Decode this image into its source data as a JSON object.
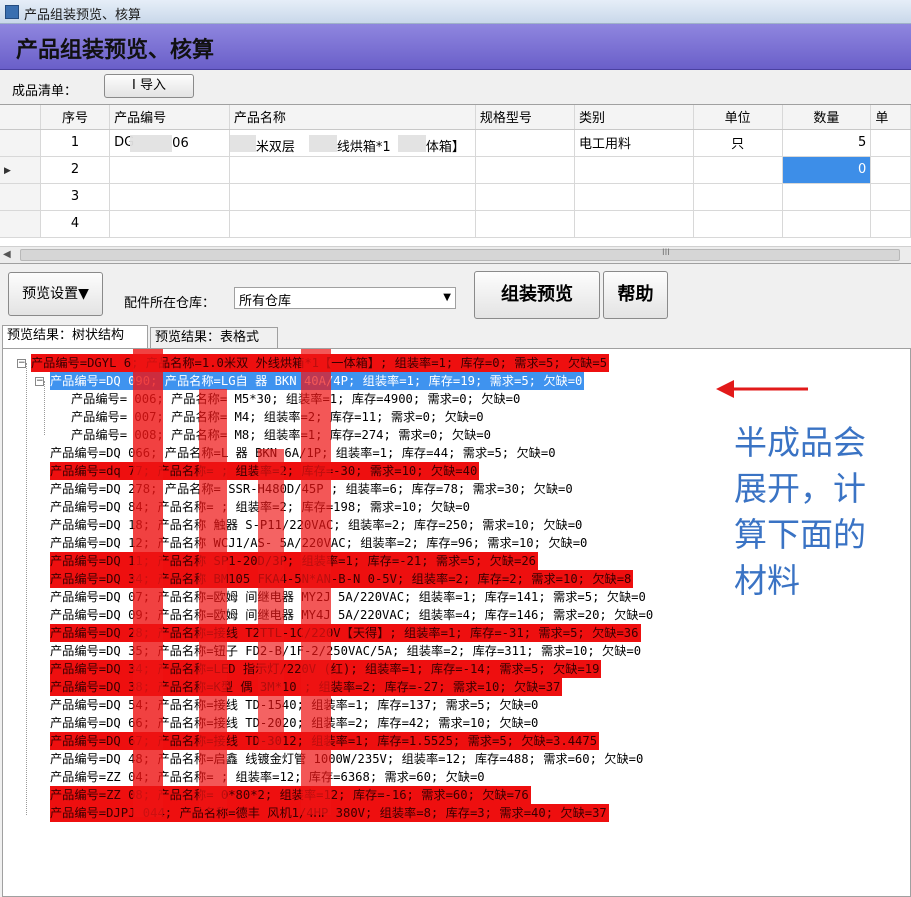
{
  "window": {
    "title": "产品组装预览、核算"
  },
  "banner": {
    "heading": "产品组装预览、核算"
  },
  "toolbar": {
    "list_label": "成品清单：",
    "import_label": "I 导入"
  },
  "grid": {
    "columns": [
      "",
      "序号",
      "产品编号",
      "产品名称",
      "规格型号",
      "类别",
      "单位",
      "数量",
      "单"
    ],
    "rows": [
      {
        "marker": "",
        "no": "1",
        "code": "DG",
        "code_tail": "06",
        "name_a": "米双层",
        "name_b": "线烘箱*1",
        "name_c": "体箱】",
        "spec": "",
        "category": "电工用料",
        "unit": "只",
        "qty": "5"
      },
      {
        "marker": "▶",
        "no": "2",
        "code": "",
        "code_tail": "",
        "name_a": "",
        "name_b": "",
        "name_c": "",
        "spec": "",
        "category": "",
        "unit": "",
        "qty": "0"
      },
      {
        "marker": "",
        "no": "3",
        "code": "",
        "code_tail": "",
        "name_a": "",
        "name_b": "",
        "name_c": "",
        "spec": "",
        "category": "",
        "unit": "",
        "qty": ""
      },
      {
        "marker": "",
        "no": "4",
        "code": "",
        "code_tail": "",
        "name_a": "",
        "name_b": "",
        "name_c": "",
        "spec": "",
        "category": "",
        "unit": "",
        "qty": ""
      }
    ],
    "scroll_grip": "III"
  },
  "controls": {
    "preview_settings_label": "预览设置▼",
    "warehouse_label": "配件所在仓库：",
    "warehouse_value": "所有仓库",
    "assemble_preview_label": "组装预览",
    "help_label": "帮助"
  },
  "tabs": [
    {
      "label": "预览结果：树状结构"
    },
    {
      "label": "预览结果：表格式"
    }
  ],
  "tree": [
    {
      "text": "产品编号=DGYL   6; 产品名称=1.0米双   外线烘箱*1【一体箱】; 组装率=1; 库存=0; 需求=5; 欠缺=5",
      "hl": "red"
    },
    {
      "text": "产品编号=DQ     090; 产品名称=LG自      器 BKN 40A/4P; 组装率=1; 库存=19; 需求=5; 欠缺=0",
      "hl": "blue"
    },
    {
      "text": "产品编号=   006; 产品名称=     M5*30; 组装率=1; 库存=4900; 需求=0; 欠缺=0",
      "hl": "none"
    },
    {
      "text": "产品编号=   007; 产品名称=     M4; 组装率=2; 库存=11; 需求=0; 欠缺=0",
      "hl": "none"
    },
    {
      "text": "产品编号=   008; 产品名称=     M8; 组装率=1; 库存=274; 需求=0; 欠缺=0",
      "hl": "none"
    },
    {
      "text": "产品编号=DQ    066; 产品名称=L   器 BKN  6A/1P; 组装率=1; 库存=44; 需求=5; 欠缺=0",
      "hl": "none"
    },
    {
      "text": "产品编号=dq    77; 产品名称=      ; 组装率=2; 库存=-30; 需求=10; 欠缺=40",
      "hl": "red"
    },
    {
      "text": "产品编号=DQ    278; 产品名称=     SSR-H480D/45P ; 组装率=6; 库存=78; 需求=30; 欠缺=0",
      "hl": "none"
    },
    {
      "text": "产品编号=DQ    84; 产品名称=       ; 组装率=2; 库存=198; 需求=10; 欠缺=0",
      "hl": "none"
    },
    {
      "text": "产品编号=DQ    18; 产品名称    触器 S-P11/220VAC; 组装率=2; 库存=250; 需求=10; 欠缺=0",
      "hl": "none"
    },
    {
      "text": "产品编号=DQ    12; 产品名称     WCJ1/AS- 5A/220VAC; 组装率=2; 库存=96; 需求=10; 欠缺=0",
      "hl": "none"
    },
    {
      "text": "产品编号=DQ    11; 产品名称     SP1-20D/3P; 组装率=1; 库存=-21; 需求=5; 欠缺=26",
      "hl": "red"
    },
    {
      "text": "产品编号=DQ    34; 产品名称     BM105 FKA4-5N*AN-B-N 0-5V; 组装率=2; 库存=2; 需求=10; 欠缺=8",
      "hl": "red"
    },
    {
      "text": "产品编号=DQ    07; 产品名称=欧姆    间继电器 MY2J  5A/220VAC; 组装率=1; 库存=141; 需求=5; 欠缺=0",
      "hl": "none"
    },
    {
      "text": "产品编号=DQ    09; 产品名称=欧姆    间继电器 MY4J  5A/220VAC; 组装率=4; 库存=146; 需求=20; 欠缺=0",
      "hl": "none"
    },
    {
      "text": "产品编号=DQ    28; 产品名称=接线     T2TTL-1C/220V【天得】; 组装率=1; 库存=-31; 需求=5; 欠缺=36",
      "hl": "red"
    },
    {
      "text": "产品编号=DQ    35; 产品名称=钮子     FD2-B/1F-2/250VAC/5A; 组装率=2; 库存=311; 需求=10; 欠缺=0",
      "hl": "none"
    },
    {
      "text": "产品编号=DQ    34; 产品名称=LED    指示灯/220V (红); 组装率=1; 库存=-14; 需求=5; 欠缺=19",
      "hl": "red"
    },
    {
      "text": "产品编号=DQ    38; 产品名称=K型    偶 3M*10 ; 组装率=2; 库存=-27; 需求=10; 欠缺=37",
      "hl": "red"
    },
    {
      "text": "产品编号=DQ    54; 产品名称=接线     TD-1540; 组装率=1; 库存=137; 需求=5; 欠缺=0",
      "hl": "none"
    },
    {
      "text": "产品编号=DQ    66; 产品名称=接线     TD-2020; 组装率=2; 库存=42; 需求=10; 欠缺=0",
      "hl": "none"
    },
    {
      "text": "产品编号=DQ    67; 产品名称=接线     TD-3012; 组装率=1; 库存=1.5525; 需求=5; 欠缺=3.4475",
      "hl": "red"
    },
    {
      "text": "产品编号=DQ    48; 产品名称=启鑫    线镀金灯管 1000W/235V; 组装率=12; 库存=488; 需求=60; 欠缺=0",
      "hl": "none"
    },
    {
      "text": "产品编号=ZZ    04; 产品名称=      ; 组装率=12; 库存=6368; 需求=60; 欠缺=0",
      "hl": "none"
    },
    {
      "text": "产品编号=ZZ    08; 产品名称=     0*80*2; 组装率=12; 库存=-16; 需求=60; 欠缺=76",
      "hl": "red"
    },
    {
      "text": "产品编号=DJPJ 044; 产品名称=德丰    风机1/4HP 380V; 组装率=8; 库存=3; 需求=40; 欠缺=37",
      "hl": "red"
    }
  ],
  "annotation": {
    "lines": [
      "半成品会",
      "展开，计",
      "算下面的",
      "材料"
    ],
    "color": "#3a73c4"
  },
  "colors": {
    "banner": "#7a70d6",
    "shortage_row": "#ee0f0f",
    "selected_row": "#3f93ef"
  }
}
